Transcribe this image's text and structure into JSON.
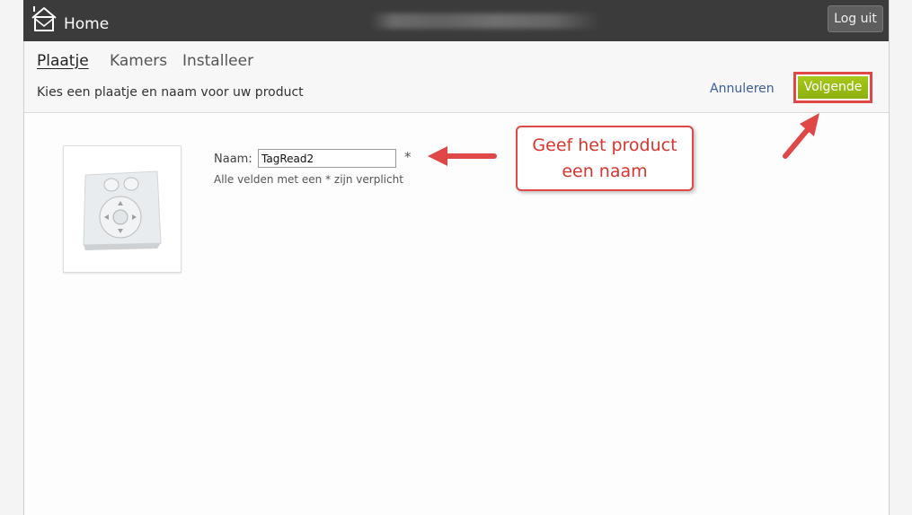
{
  "header": {
    "home_label": "Home",
    "logout_label": "Log uit"
  },
  "tabs": [
    {
      "label": "Plaatje",
      "active": true
    },
    {
      "label": "Kamers",
      "active": false
    },
    {
      "label": "Installeer",
      "active": false
    }
  ],
  "subheader": {
    "instruction": "Kies een plaatje en naam voor uw product",
    "cancel_label": "Annuleren",
    "next_label": "Volgende"
  },
  "form": {
    "name_label": "Naam:",
    "name_value": "TagRead2",
    "required_marker": "*",
    "required_note": "Alle velden met een * zijn verplicht"
  },
  "callout": {
    "line1": "Geef het product",
    "line2": "een naam"
  },
  "colors": {
    "topbar": "#3b3b3b",
    "accent_green": "#9dc116",
    "annotation_red": "#e04848",
    "link_blue": "#3b5e9c"
  },
  "icons": [
    "home-icon",
    "product-image",
    "arrow-left",
    "arrow-up-right"
  ]
}
